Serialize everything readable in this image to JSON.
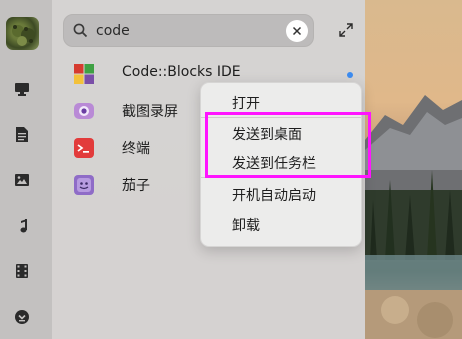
{
  "search": {
    "value": "code"
  },
  "apps": [
    {
      "label": "Code::Blocks IDE",
      "icon": "codeblocks-icon"
    },
    {
      "label": "截图录屏",
      "icon": "screenshot-icon"
    },
    {
      "label": "终端",
      "icon": "terminal-icon"
    },
    {
      "label": "茄子",
      "icon": "cheese-icon"
    }
  ],
  "context_menu": {
    "items": [
      "打开",
      "发送到桌面",
      "发送到任务栏",
      "开机自动启动",
      "卸载"
    ]
  },
  "sidebar": {
    "icons": [
      "computer-icon",
      "document-icon",
      "image-icon",
      "music-icon",
      "video-icon",
      "download-icon"
    ]
  },
  "colors": {
    "highlight": "#ff14ff",
    "indicator_dot": "#3d8cf0"
  }
}
